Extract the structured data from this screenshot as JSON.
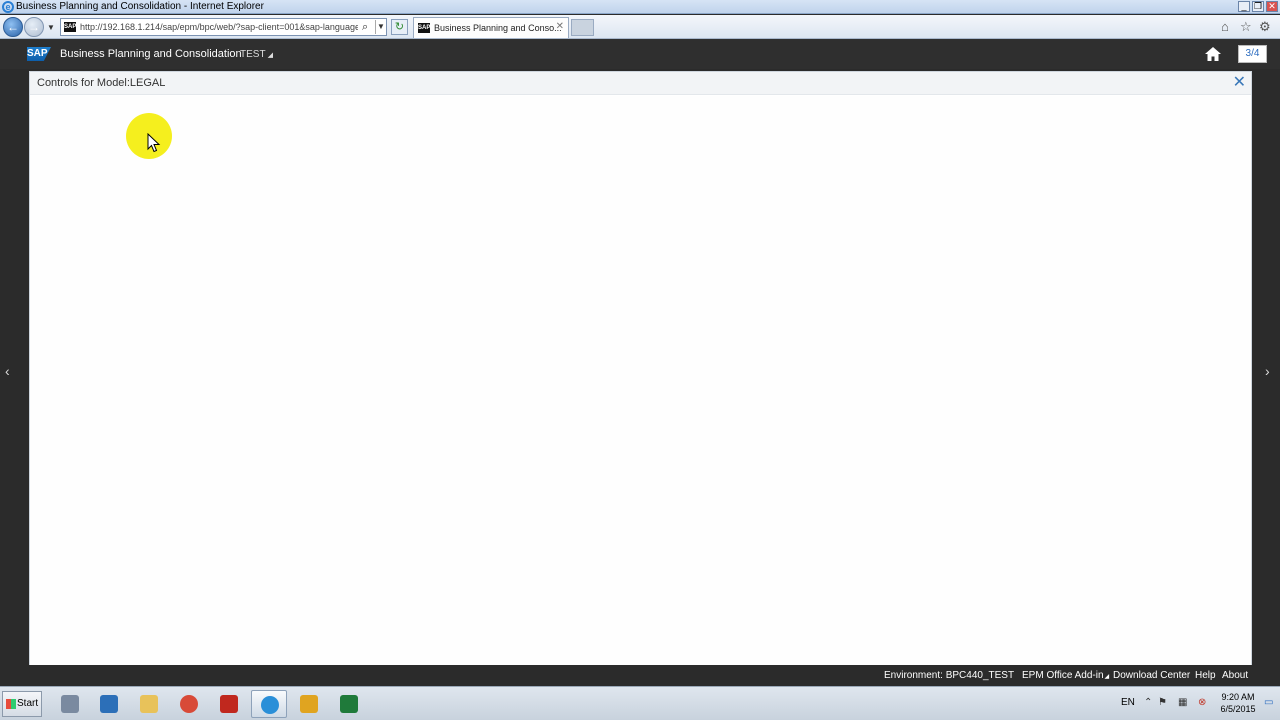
{
  "browser": {
    "window_title": "Business Planning and Consolidation - Internet Explorer",
    "address_url": "http://192.168.1.214/sap/epm/bpc/web/?sap-client=001&sap-language",
    "tab_title": "Business Planning and Conso...",
    "window_controls": {
      "minimize": "_",
      "maximize": "❐",
      "close": "✕"
    }
  },
  "shell": {
    "logo_text": "SAP",
    "app_title": "Business Planning and Consolidation",
    "environment_menu": "TEST",
    "page_counter": "3/4"
  },
  "dialog": {
    "title": "Controls for Model:LEGAL",
    "close_glyph": "✕"
  },
  "nav": {
    "prev_glyph": "‹",
    "next_glyph": "›"
  },
  "footer": {
    "environment": "Environment: BPC440_TEST",
    "epm_addin": "EPM Office Add-in",
    "download_center": "Download Center",
    "help": "Help",
    "about": "About"
  },
  "taskbar": {
    "start_label": "Start",
    "language": "EN",
    "time": "9:20 AM",
    "date": "6/5/2015",
    "apps": [
      {
        "name": "server-manager",
        "color": "#7a8aa0"
      },
      {
        "name": "powershell",
        "color": "#2c6fb8"
      },
      {
        "name": "file-explorer",
        "color": "#e8c25a"
      },
      {
        "name": "chrome",
        "color": "#d84a38"
      },
      {
        "name": "acrobat",
        "color": "#c0281e"
      },
      {
        "name": "internet-explorer",
        "color": "#2a8fd8"
      },
      {
        "name": "outlook",
        "color": "#e0a420"
      },
      {
        "name": "excel",
        "color": "#1f7a3a"
      }
    ]
  }
}
